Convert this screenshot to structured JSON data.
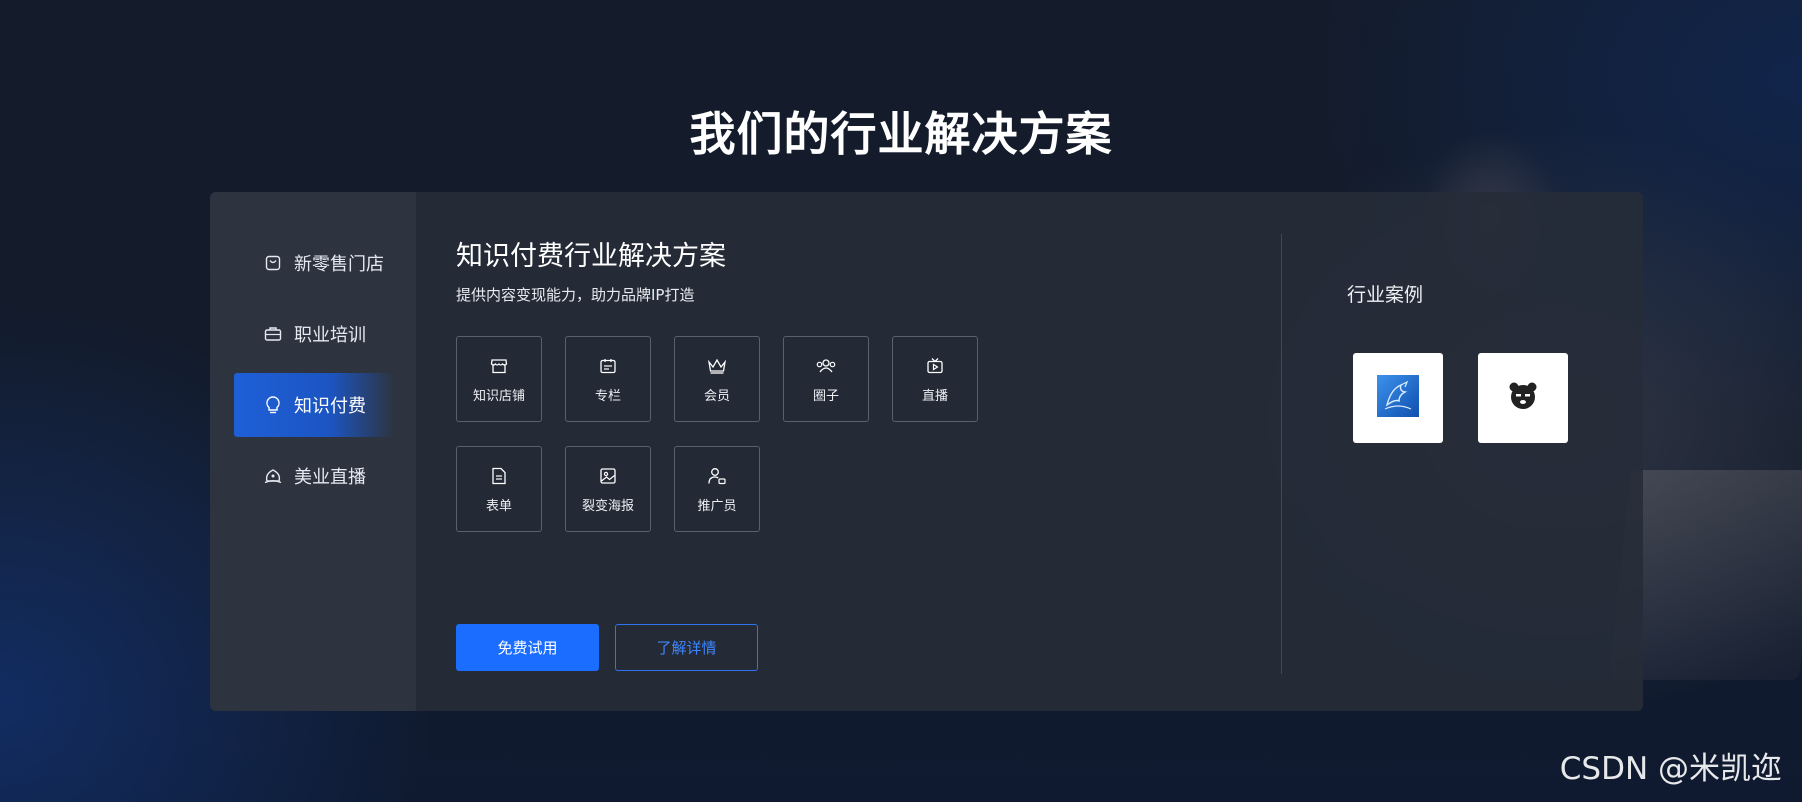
{
  "page_title": "我们的行业解决方案",
  "sidebar": {
    "items": [
      {
        "label": "新零售门店",
        "icon": "shopping-bag-icon",
        "active": false
      },
      {
        "label": "职业培训",
        "icon": "briefcase-icon",
        "active": false
      },
      {
        "label": "知识付费",
        "icon": "lightbulb-icon",
        "active": true
      },
      {
        "label": "美业直播",
        "icon": "beauty-icon",
        "active": false
      }
    ]
  },
  "solution": {
    "title": "知识付费行业解决方案",
    "subtitle": "提供内容变现能力，助力品牌IP打造",
    "features": [
      {
        "label": "知识店铺",
        "icon": "store-icon"
      },
      {
        "label": "专栏",
        "icon": "column-icon"
      },
      {
        "label": "会员",
        "icon": "crown-icon"
      },
      {
        "label": "圈子",
        "icon": "group-icon"
      },
      {
        "label": "直播",
        "icon": "live-tv-icon"
      },
      {
        "label": "表单",
        "icon": "form-icon"
      },
      {
        "label": "裂变海报",
        "icon": "poster-icon"
      },
      {
        "label": "推广员",
        "icon": "promoter-icon"
      }
    ],
    "primary_button": "免费试用",
    "secondary_button": "了解详情"
  },
  "cases": {
    "title": "行业案例",
    "logos": [
      {
        "icon": "blue-bird-logo-icon"
      },
      {
        "icon": "bear-logo-icon"
      }
    ]
  },
  "watermark": "CSDN @米凯迩",
  "colors": {
    "accent": "#1a6dff",
    "sidebar_bg": "#2d3440",
    "panel_bg": "#262c38",
    "page_bg": "#131b2b"
  }
}
